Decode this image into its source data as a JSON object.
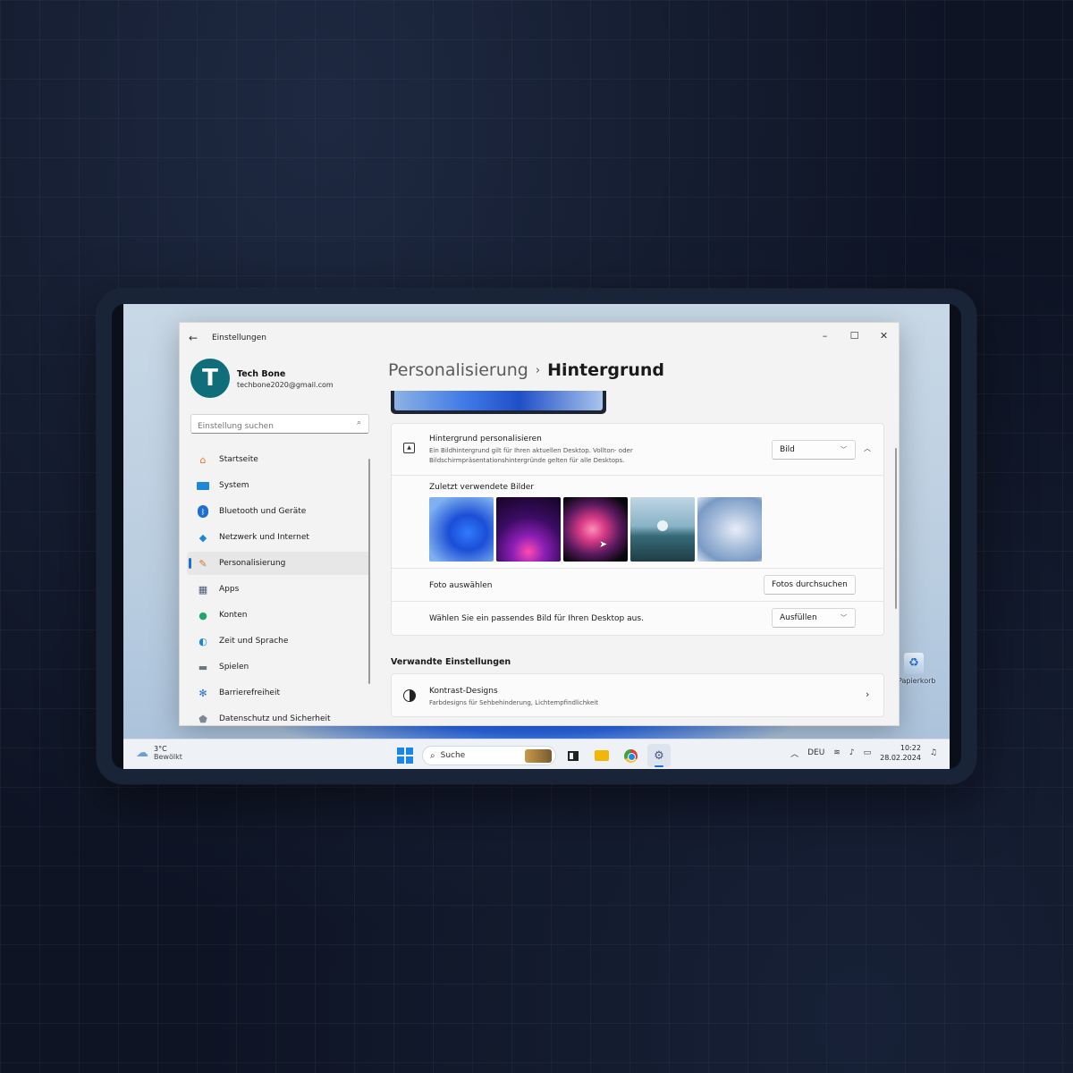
{
  "window": {
    "title": "Einstellungen",
    "minimize": "–",
    "maximize": "☐",
    "close": "✕"
  },
  "profile": {
    "initial": "T",
    "name": "Tech Bone",
    "email": "techbone2020@gmail.com"
  },
  "search": {
    "placeholder": "Einstellung suchen"
  },
  "nav": [
    {
      "label": "Startseite",
      "icon": "home-icon"
    },
    {
      "label": "System",
      "icon": "monitor-icon"
    },
    {
      "label": "Bluetooth und Geräte",
      "icon": "bluetooth-icon"
    },
    {
      "label": "Netzwerk und Internet",
      "icon": "wifi-icon"
    },
    {
      "label": "Personalisierung",
      "icon": "brush-icon",
      "active": true
    },
    {
      "label": "Apps",
      "icon": "apps-icon"
    },
    {
      "label": "Konten",
      "icon": "person-icon"
    },
    {
      "label": "Zeit und Sprache",
      "icon": "globe-clock-icon"
    },
    {
      "label": "Spielen",
      "icon": "gamepad-icon"
    },
    {
      "label": "Barrierefreiheit",
      "icon": "accessibility-icon"
    },
    {
      "label": "Datenschutz und Sicherheit",
      "icon": "shield-icon"
    }
  ],
  "breadcrumb": {
    "parent": "Personalisierung",
    "separator": "›",
    "current": "Hintergrund"
  },
  "background": {
    "title": "Hintergrund personalisieren",
    "description_line1": "Ein Bildhintergrund gilt für Ihren aktuellen Desktop. Vollton- oder",
    "description_line2": "Bildschirmpräsentationshintergründe gelten für alle Desktops.",
    "type_value": "Bild",
    "recent_label": "Zuletzt verwendete Bilder",
    "choose_photo_label": "Foto auswählen",
    "browse_button": "Fotos durchsuchen",
    "fit_label": "Wählen Sie ein passendes Bild für Ihren Desktop aus.",
    "fit_value": "Ausfüllen"
  },
  "related": {
    "heading": "Verwandte Einstellungen",
    "contrast_title": "Kontrast-Designs",
    "contrast_desc": "Farbdesigns für Sehbehinderung, Lichtempfindlichkeit"
  },
  "desktop": {
    "recycle_label": "Papierkorb"
  },
  "taskbar": {
    "weather_temp": "3°C",
    "weather_desc": "Bewölkt",
    "search_text": "Suche",
    "language": "DEU",
    "time": "10:22",
    "date": "28.02.2024"
  },
  "colors": {
    "accent": "#1e6fd0",
    "avatar": "#0f6e7a"
  }
}
